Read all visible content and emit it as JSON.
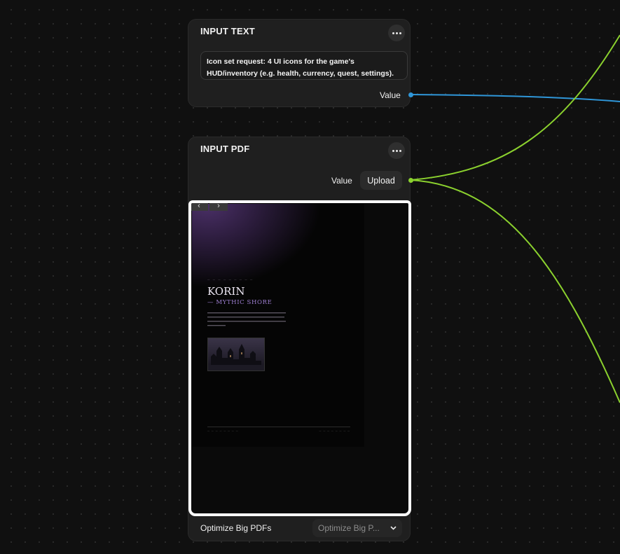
{
  "colors": {
    "text_port": "#2f96d8",
    "pdf_port": "#8bd12e",
    "node_bg": "#1f1f1f",
    "canvas_bg": "#101010"
  },
  "input_text_node": {
    "title": "INPUT TEXT",
    "text_value": "Icon set request: 4 UI icons for the game's HUD/inventory (e.g. health, currency, quest, settings).",
    "port_label": "Value"
  },
  "input_pdf_node": {
    "title": "INPUT PDF",
    "port_label": "Value",
    "upload_label": "Upload",
    "nav_prev": "‹",
    "nav_next": "›",
    "pdf_preview": {
      "title": "KORIN",
      "subtitle": "— MYTHIC SHORE"
    },
    "optimize_label": "Optimize Big PDFs",
    "optimize_select_value": "Optimize Big P..."
  }
}
